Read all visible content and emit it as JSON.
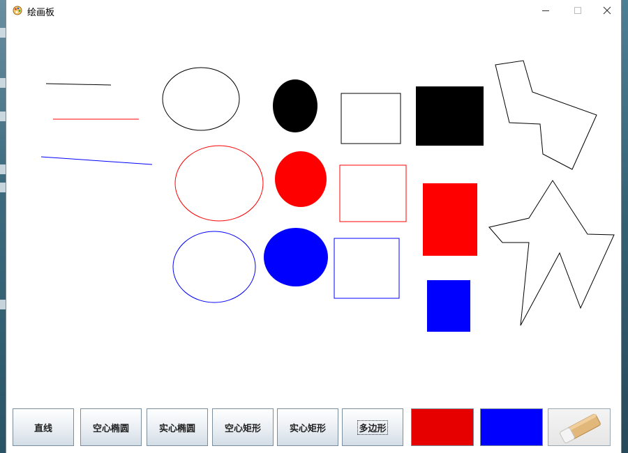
{
  "window": {
    "title": "绘画板",
    "controls": {
      "minimize": "—",
      "maximize": "☐",
      "close": "✕"
    }
  },
  "toolbar": {
    "buttons": [
      {
        "label": "直线"
      },
      {
        "label": "空心椭圆"
      },
      {
        "label": "实心椭圆"
      },
      {
        "label": "空心矩形"
      },
      {
        "label": "实心矩形"
      },
      {
        "label": "多边形"
      }
    ],
    "colors": [
      {
        "name": "red-swatch",
        "color": "#e60000"
      },
      {
        "name": "blue-swatch",
        "color": "#0000ff"
      }
    ],
    "eraser_icon": "eraser-icon"
  },
  "palette": {
    "black": "#000000",
    "red": "#ff0000",
    "blue": "#0000ff"
  }
}
